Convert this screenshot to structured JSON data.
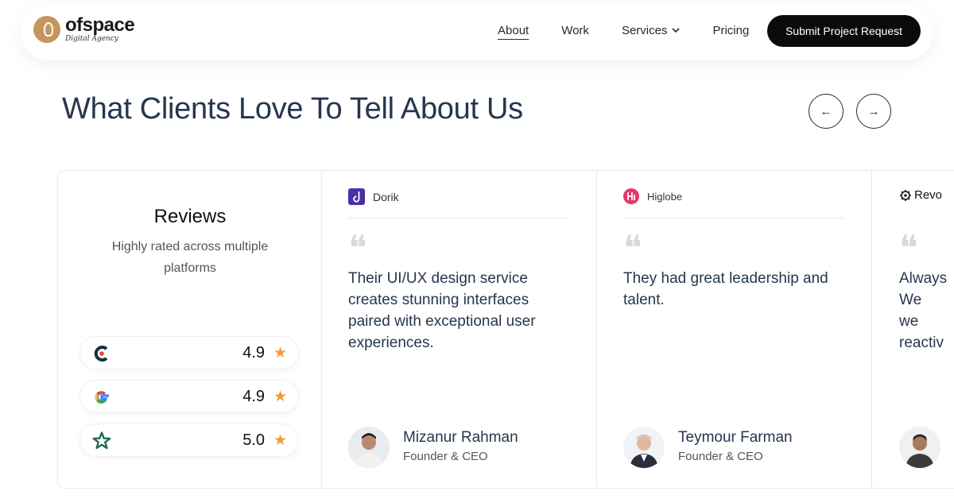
{
  "brand": {
    "name": "ofspace",
    "tagline": "Digital Agency",
    "color": "#c4965f"
  },
  "nav": {
    "links": [
      {
        "label": "About",
        "active": true
      },
      {
        "label": "Work"
      },
      {
        "label": "Services",
        "icon": "chevron-down-icon"
      },
      {
        "label": "Pricing"
      }
    ],
    "cta": "Submit Project Request"
  },
  "section": {
    "headline": "What Clients Love To Tell About Us",
    "prev_icon": "←",
    "next_icon": "→"
  },
  "reviews": {
    "title": "Reviews",
    "subtitle": "Highly rated across multiple platforms",
    "platforms": [
      {
        "icon": "clutch-icon",
        "score": "4.9"
      },
      {
        "icon": "google-icon",
        "score": "4.9"
      },
      {
        "icon": "star-outline-icon",
        "score": "5.0"
      }
    ],
    "star": "★",
    "star_color": "#f29a3a"
  },
  "testimonials": [
    {
      "company": "Dorik",
      "quote_mark": "❝",
      "quote": "Their UI/UX design service creates stunning interfaces paired with exceptional user experiences.",
      "name": "Mizanur Rahman",
      "role": "Founder & CEO"
    },
    {
      "company": "Higlobe",
      "quote_mark": "❝",
      "quote": "They had great leadership and talent.",
      "name": "Teymour Farman",
      "role": "Founder & CEO"
    },
    {
      "company": "Revo",
      "quote_mark": "❝",
      "quote": "Always We we reactiv"
    }
  ]
}
